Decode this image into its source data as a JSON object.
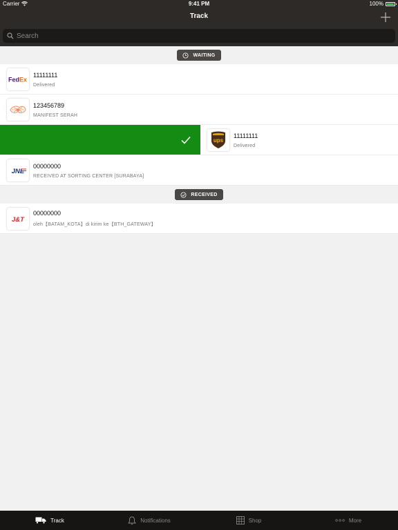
{
  "status_bar": {
    "carrier": "Carrier",
    "time": "9:41 PM",
    "battery": "100%"
  },
  "nav": {
    "title": "Track"
  },
  "search": {
    "placeholder": "Search"
  },
  "sections": [
    {
      "title": "WAITING",
      "items": [
        {
          "number": "11111111",
          "status": "Delivered",
          "logo": "fedex-logo"
        },
        {
          "number": "123456789",
          "status": "MANIFEST SERAH",
          "logo": "pos-indonesia-logo"
        },
        {
          "number": "11111111",
          "status": "Delivered",
          "logo": "ups-logo",
          "swiped": true
        },
        {
          "number": "00000000",
          "status": "RECEIVED AT SORTING CENTER [SURABAYA]",
          "logo": "jne-logo"
        }
      ]
    },
    {
      "title": "RECEIVED",
      "items": [
        {
          "number": "00000000",
          "status": "oleh【BATAM_KOTA】di kirim ke【BTH_GATEWAY】",
          "logo": "jnt-logo"
        }
      ]
    }
  ],
  "logos": {
    "fedex_fed": "Fed",
    "fedex_ex": "Ex",
    "ups": "ups",
    "jne": "JNE",
    "jnt": "J&T"
  },
  "swipe_action": {
    "icon": "checkmark-icon",
    "color": "#148b12"
  },
  "tabs": [
    {
      "label": "Track",
      "icon": "truck-icon",
      "active": true
    },
    {
      "label": "Notifications",
      "icon": "bell-icon",
      "active": false
    },
    {
      "label": "Shop",
      "icon": "shop-icon",
      "active": false
    },
    {
      "label": "More",
      "icon": "more-icon",
      "active": false
    }
  ],
  "colors": {
    "bar": "#2d2a27",
    "tabbar": "#161514",
    "action_green": "#148b12",
    "battery": "#4cd964"
  }
}
